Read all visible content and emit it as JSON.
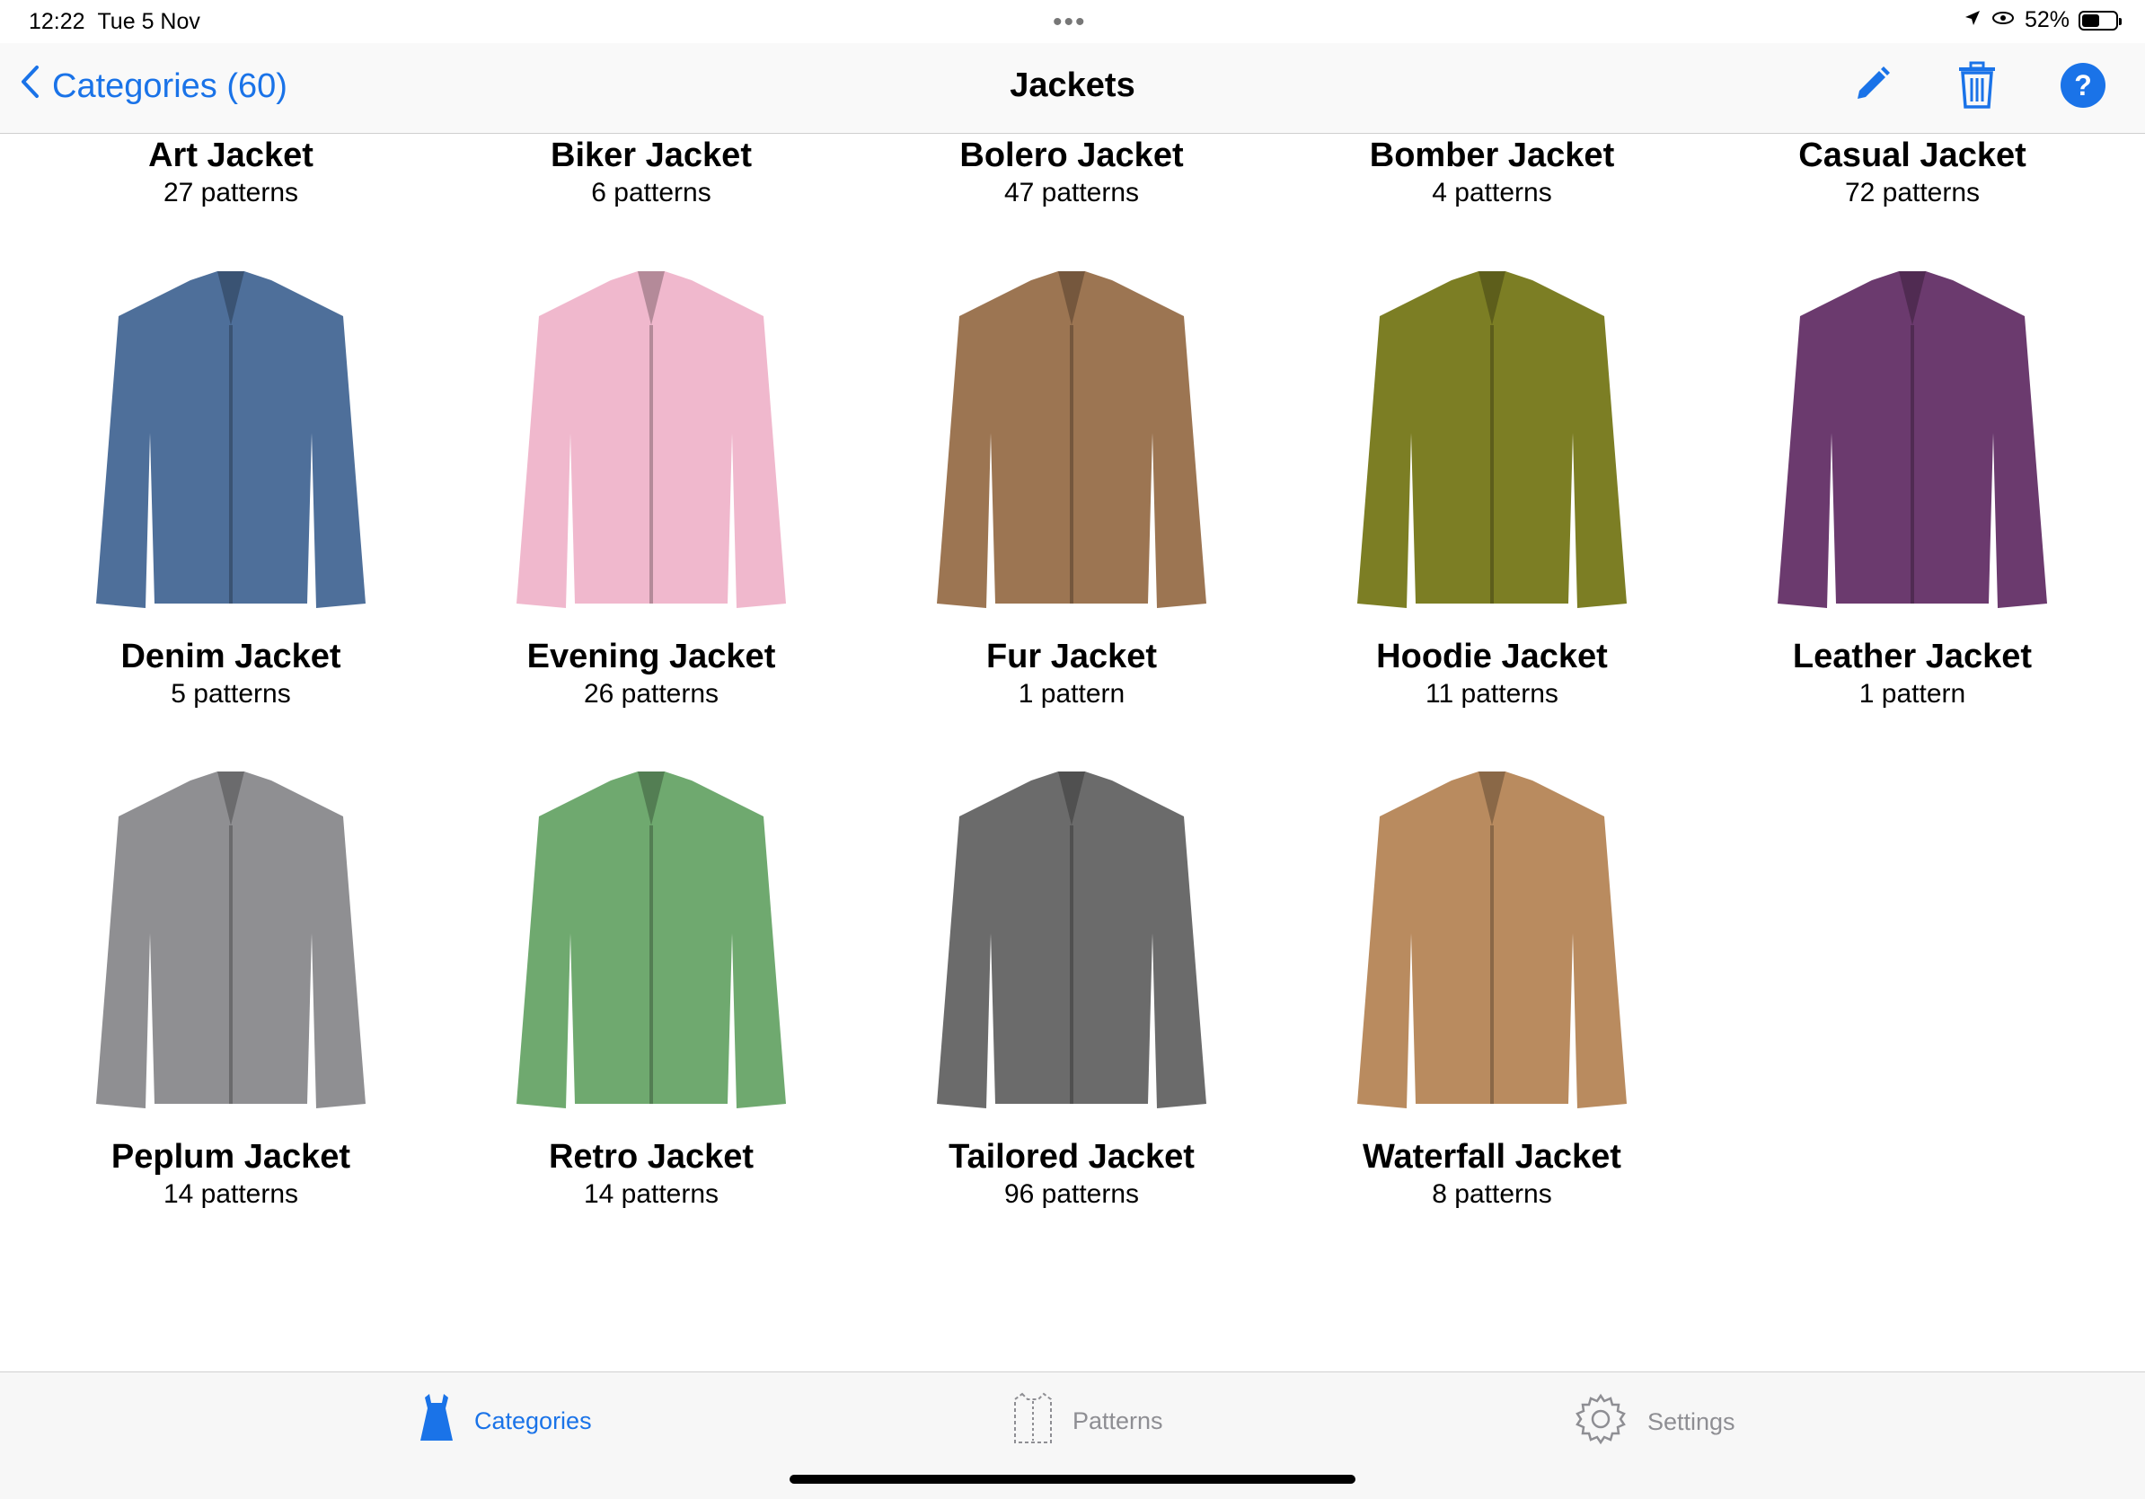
{
  "status": {
    "time": "12:22",
    "date": "Tue 5 Nov",
    "battery": "52%",
    "battery_level": 0.52
  },
  "nav": {
    "back_label": "Categories (60)",
    "title": "Jackets"
  },
  "items": [
    {
      "name": "Art Jacket",
      "count": "27 patterns",
      "color": "#e9e6df"
    },
    {
      "name": "Biker Jacket",
      "count": "6 patterns",
      "color": "#6a3d8f"
    },
    {
      "name": "Bolero Jacket",
      "count": "47 patterns",
      "color": "#cfc7ea"
    },
    {
      "name": "Bomber Jacket",
      "count": "4 patterns",
      "color": "#6fb3a8"
    },
    {
      "name": "Casual Jacket",
      "count": "72 patterns",
      "color": "#a9a9a9"
    },
    {
      "name": "Denim Jacket",
      "count": "5 patterns",
      "color": "#4e6f9a"
    },
    {
      "name": "Evening Jacket",
      "count": "26 patterns",
      "color": "#f0b8cd"
    },
    {
      "name": "Fur Jacket",
      "count": "1 pattern",
      "color": "#9c7552"
    },
    {
      "name": "Hoodie Jacket",
      "count": "11 patterns",
      "color": "#7c7e24"
    },
    {
      "name": "Leather Jacket",
      "count": "1 pattern",
      "color": "#6b3a6e"
    },
    {
      "name": "Peplum Jacket",
      "count": "14 patterns",
      "color": "#8f8f92"
    },
    {
      "name": "Retro Jacket",
      "count": "14 patterns",
      "color": "#6fa96f"
    },
    {
      "name": "Tailored Jacket",
      "count": "96 patterns",
      "color": "#6b6b6b"
    },
    {
      "name": "Waterfall Jacket",
      "count": "8 patterns",
      "color": "#b98b5f"
    }
  ],
  "tabs": {
    "categories": "Categories",
    "patterns": "Patterns",
    "settings": "Settings"
  },
  "colors": {
    "accent": "#1a73e8",
    "inactive": "#8e8e93"
  },
  "icons": {
    "back": "chevron-left-icon",
    "edit": "pencil-icon",
    "delete": "trash-icon",
    "help": "question-icon",
    "categories": "dress-icon",
    "patterns": "pattern-icon",
    "settings": "gear-icon"
  }
}
